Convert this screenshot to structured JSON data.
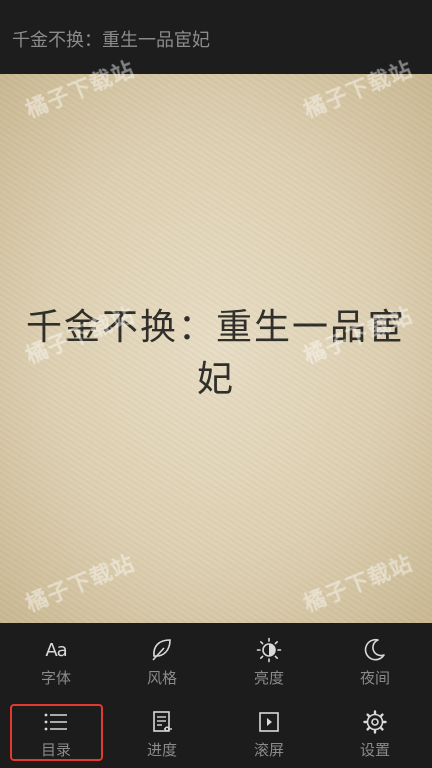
{
  "header": {
    "title": "千金不换：重生一品宦妃"
  },
  "page": {
    "book_title": "千金不换：重生一品宦妃"
  },
  "watermark": {
    "text": "橘子下载站"
  },
  "menu": {
    "row1": [
      {
        "label": "字体",
        "icon": "font-icon",
        "glyph": "Aa"
      },
      {
        "label": "风格",
        "icon": "leaf-icon"
      },
      {
        "label": "亮度",
        "icon": "brightness-icon"
      },
      {
        "label": "夜间",
        "icon": "moon-icon"
      }
    ],
    "row2": [
      {
        "label": "目录",
        "icon": "list-icon"
      },
      {
        "label": "进度",
        "icon": "progress-icon"
      },
      {
        "label": "滚屏",
        "icon": "autoscroll-icon"
      },
      {
        "label": "设置",
        "icon": "gear-icon"
      }
    ]
  },
  "colors": {
    "highlight": "#e23a2f",
    "paper": "#e1d5b8",
    "bar": "#1c1c1c"
  }
}
